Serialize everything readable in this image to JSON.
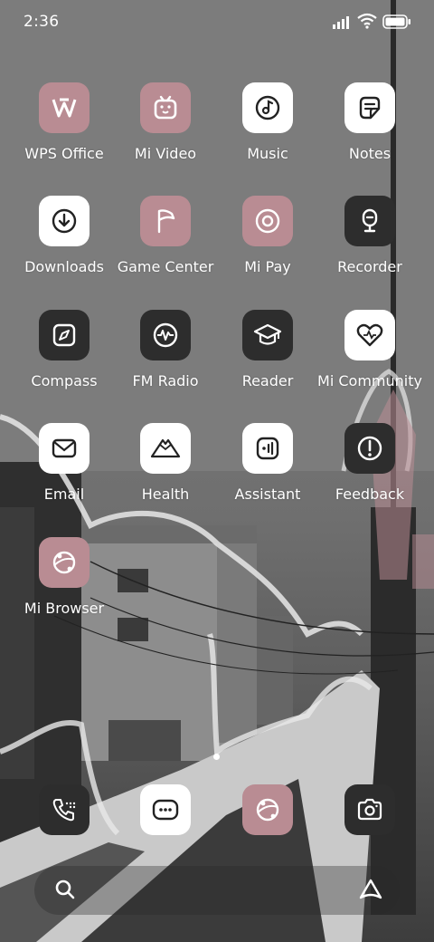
{
  "status_bar": {
    "time": "2:36"
  },
  "apps": [
    {
      "label": "WPS Office",
      "style": "pink",
      "icon": "wps-office-icon"
    },
    {
      "label": "Mi Video",
      "style": "pink",
      "icon": "mi-video-icon"
    },
    {
      "label": "Music",
      "style": "white",
      "icon": "music-icon"
    },
    {
      "label": "Notes",
      "style": "white",
      "icon": "notes-icon"
    },
    {
      "label": "Downloads",
      "style": "white",
      "icon": "downloads-icon"
    },
    {
      "label": "Game Center",
      "style": "pink",
      "icon": "game-center-icon"
    },
    {
      "label": "Mi Pay",
      "style": "pink",
      "icon": "mi-pay-icon"
    },
    {
      "label": "Recorder",
      "style": "dark",
      "icon": "recorder-icon"
    },
    {
      "label": "Compass",
      "style": "dark",
      "icon": "compass-icon"
    },
    {
      "label": "FM Radio",
      "style": "dark",
      "icon": "fm-radio-icon"
    },
    {
      "label": "Reader",
      "style": "dark",
      "icon": "reader-icon"
    },
    {
      "label": "Mi Community",
      "style": "white",
      "icon": "mi-community-icon"
    },
    {
      "label": "Email",
      "style": "white",
      "icon": "email-icon"
    },
    {
      "label": "Health",
      "style": "white",
      "icon": "health-icon"
    },
    {
      "label": "Assistant",
      "style": "white",
      "icon": "assistant-icon"
    },
    {
      "label": "Feedback",
      "style": "dark",
      "icon": "feedback-icon"
    },
    {
      "label": "Mi Browser",
      "style": "pink",
      "icon": "mi-browser-icon"
    }
  ],
  "dock": [
    {
      "icon": "phone-icon",
      "style": "dark"
    },
    {
      "icon": "messages-icon",
      "style": "white"
    },
    {
      "icon": "browser-icon",
      "style": "pink"
    },
    {
      "icon": "camera-icon",
      "style": "dark"
    }
  ],
  "page_indicator": {
    "current": 1,
    "total": 1
  },
  "colors": {
    "pink": "#b98c93",
    "white": "#ffffff",
    "dark": "#2d2d2d"
  }
}
